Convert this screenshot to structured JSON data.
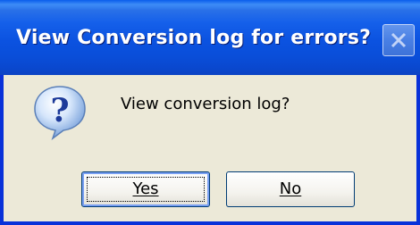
{
  "dialog": {
    "title": "View Conversion log for errors?",
    "message": "View conversion log?",
    "icon": "question-icon",
    "close_icon": "close-icon"
  },
  "buttons": {
    "yes_label": "Yes",
    "no_label": "No"
  },
  "colors": {
    "titlebar": "#0A4ED9",
    "frame": "#0831D9",
    "body": "#ECE9D8"
  }
}
